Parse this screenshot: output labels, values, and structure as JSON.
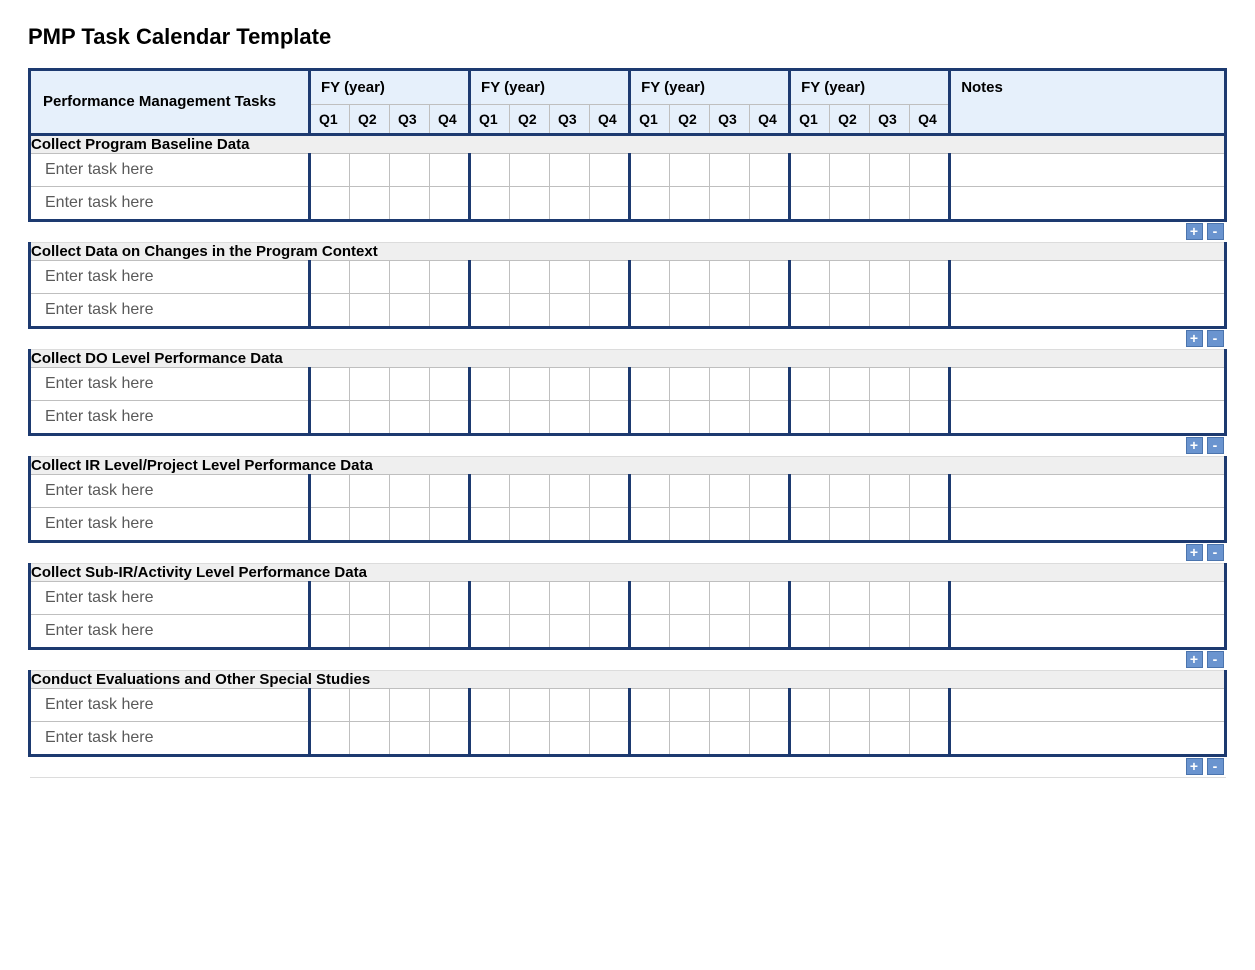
{
  "title": "PMP Task Calendar Template",
  "header": {
    "tasks": "Performance Management Tasks",
    "fy": "FY  (year)",
    "notes": "Notes",
    "quarters": [
      "Q1",
      "Q2",
      "Q3",
      "Q4"
    ]
  },
  "task_placeholder": "Enter task here",
  "buttons": {
    "add": "+",
    "remove": "-"
  },
  "sections": [
    {
      "title": "Collect Program Baseline Data"
    },
    {
      "title": "Collect Data on Changes in the Program Context"
    },
    {
      "title": "Collect DO Level Performance Data"
    },
    {
      "title": "Collect IR Level/Project Level Performance Data"
    },
    {
      "title": "Collect Sub-IR/Activity Level Performance Data"
    },
    {
      "title": "Conduct Evaluations and Other Special Studies"
    }
  ]
}
